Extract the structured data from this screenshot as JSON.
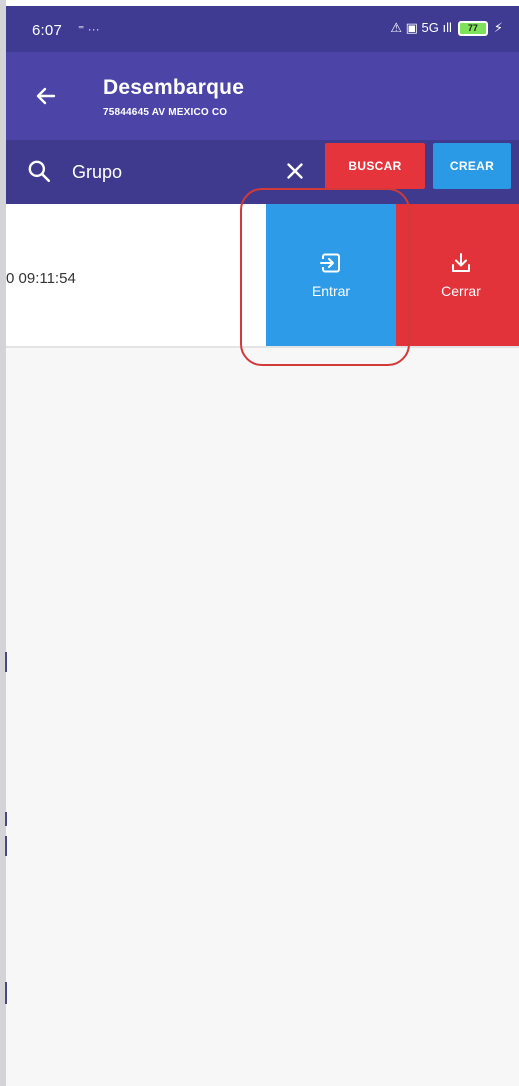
{
  "status_bar": {
    "time": "6:07",
    "left_icons": "⁼ ···",
    "right_icons": "⚠ ▣ 5G ıll",
    "battery": "77"
  },
  "app_bar": {
    "title": "Desembarque",
    "subtitle": "75844645 AV MEXICO CO"
  },
  "search": {
    "placeholder": "Grupo",
    "value": ""
  },
  "buttons": {
    "buscar": "BUSCAR",
    "crear": "CREAR"
  },
  "row": {
    "text": "0 09:11:54"
  },
  "actions": {
    "entrar": "Entrar",
    "cerrar": "Cerrar"
  },
  "colors": {
    "app_bar": "#4d44a7",
    "search_bar": "#3f3a8e",
    "buscar": "#e5343c",
    "crear": "#2b9ae6",
    "entrar": "#2d9be7",
    "cerrar": "#e2323a",
    "highlight": "#d23a3a"
  }
}
